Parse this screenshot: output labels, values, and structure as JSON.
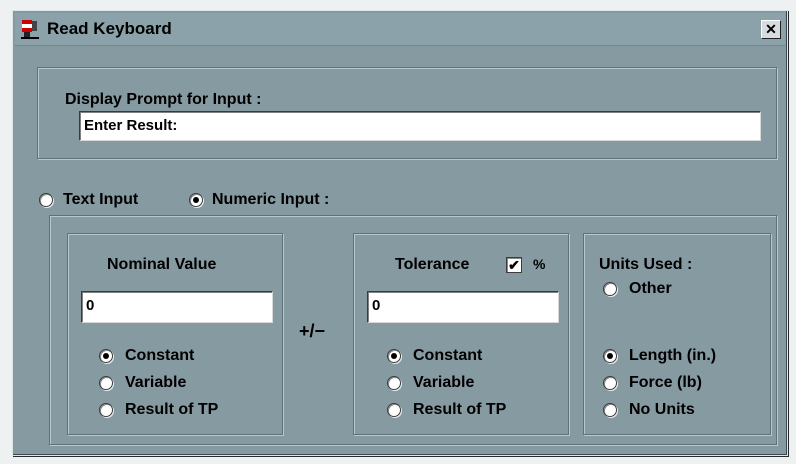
{
  "window": {
    "title": "Read Keyboard",
    "close_glyph": "✕"
  },
  "prompt": {
    "label": "Display Prompt for Input :",
    "value": "Enter Result:"
  },
  "input_type": {
    "text_label": "Text Input",
    "numeric_label": "Numeric Input :",
    "selected": "numeric"
  },
  "nominal": {
    "title": "Nominal Value",
    "value": "0",
    "options": [
      "Constant",
      "Variable",
      "Result of TP"
    ],
    "selected": "Constant"
  },
  "plusminus": "+/−",
  "tolerance": {
    "title": "Tolerance",
    "percent_label": "%",
    "percent_checked": true,
    "check_glyph": "✔",
    "value": "0",
    "options": [
      "Constant",
      "Variable",
      "Result of TP"
    ],
    "selected": "Constant"
  },
  "units": {
    "title": "Units Used :",
    "other_label": "Other",
    "options": [
      "Length (in.)",
      "Force (lb)",
      "No Units"
    ],
    "selected": "Length (in.)"
  },
  "colors": {
    "window_bg": "#869aa2",
    "desktop_bg": "#eef1f2"
  },
  "icons": {
    "app": "signal-tower-icon",
    "close": "close-icon"
  }
}
